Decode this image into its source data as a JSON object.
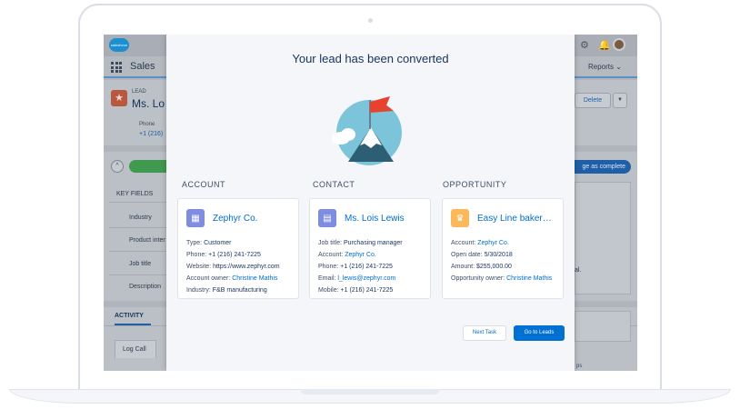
{
  "app": {
    "logo_text": "salesforce",
    "name": "Sales",
    "nav_tab": "Reports",
    "nav_tab_chevron": "⌄"
  },
  "icons": {
    "gear": "gear-icon",
    "bell": "bell-icon",
    "lead": "star-icon",
    "account": "building-icon",
    "contact": "contact-card-icon",
    "opportunity": "crown-icon"
  },
  "colors": {
    "primary": "#0070d2",
    "link": "#006dcc",
    "account_icon": "#7f8de1",
    "contact_icon": "#7f8de1",
    "opportunity_icon": "#fcb95b",
    "path_complete": "#4bca81",
    "lead_icon": "#f88962"
  },
  "record": {
    "object_label": "LEAD",
    "name_visible": "Ms. Lo",
    "phone_label": "Phone",
    "phone_value_visible": "+1 (216)",
    "delete_label": "Delete",
    "dropdown_glyph": "▼",
    "mark_complete_visible": "ge as complete"
  },
  "key_fields": {
    "title": "KEY FIELDS",
    "labels": [
      "Industry",
      "Product inter",
      "Job title",
      "Description"
    ]
  },
  "right_fragments": {
    "panel_text": "al.",
    "bottom_text": "ps"
  },
  "activity": {
    "tab_label": "ACTIVITY",
    "log_call_label": "Log Call"
  },
  "modal": {
    "title": "Your lead has been converted",
    "account": {
      "section_label": "ACCOUNT",
      "name": "Zephyr Co.",
      "fields": [
        {
          "label": "Type: ",
          "value": "Customer",
          "link": false
        },
        {
          "label": "Phone: ",
          "value": "+1 (216) 241-7225",
          "link": false
        },
        {
          "label": "Website: ",
          "value": "https://www.zephyr.com",
          "link": false
        },
        {
          "label": "Account owner: ",
          "value": "Christine Mathis",
          "link": true
        },
        {
          "label": "Industry: ",
          "value": "F&B manufacturing",
          "link": false
        }
      ]
    },
    "contact": {
      "section_label": "CONTACT",
      "name": "Ms. Lois Lewis",
      "fields": [
        {
          "label": "Job title: ",
          "value": "Purchasing manager",
          "link": false
        },
        {
          "label": "Account: ",
          "value": "Zephyr Co.",
          "link": true
        },
        {
          "label": "Phone: ",
          "value": "+1 (216) 241-7225",
          "link": false
        },
        {
          "label": "Email: ",
          "value": "l_lewis@zephyr.com",
          "link": true
        },
        {
          "label": "Mobile: ",
          "value": "+1 (216) 241-7225",
          "link": false
        }
      ]
    },
    "opportunity": {
      "section_label": "OPPORTUNITY",
      "name": "Easy Line bakery for...",
      "fields": [
        {
          "label": "Account: ",
          "value": "Zephyr Co.",
          "link": true
        },
        {
          "label": "Open date: ",
          "value": "5/30/2018",
          "link": false
        },
        {
          "label": "Amount: ",
          "value": "$255,000.00",
          "link": false
        },
        {
          "label": "Opportunity owner: ",
          "value": "Christine Mathis",
          "link": true
        }
      ]
    },
    "next_task_label": "Next Task",
    "go_to_leads_label": "Go to Leads"
  }
}
